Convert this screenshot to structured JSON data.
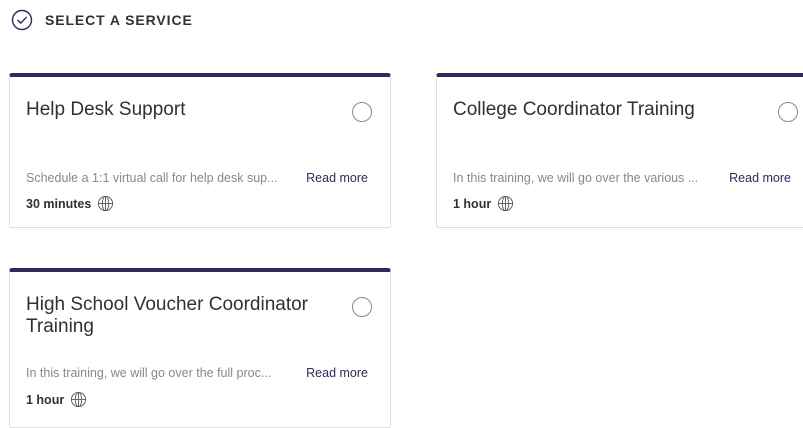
{
  "header": {
    "icon": "check-circle-icon",
    "title": "SELECT A SERVICE"
  },
  "accent_color": "#2e2a5a",
  "services": [
    {
      "name": "Help Desk Support",
      "description": "Schedule a 1:1 virtual call for help desk sup...",
      "read_more": "Read more",
      "duration": "30 minutes",
      "icon": "globe-icon"
    },
    {
      "name": "College Coordinator Training",
      "description": "In this training, we will go over the various ...",
      "read_more": "Read more",
      "duration": "1 hour",
      "icon": "globe-icon"
    },
    {
      "name": "High School Voucher Coordinator Training",
      "description": "In this training, we will go over the full proc...",
      "read_more": "Read more",
      "duration": "1 hour",
      "icon": "globe-icon"
    }
  ]
}
